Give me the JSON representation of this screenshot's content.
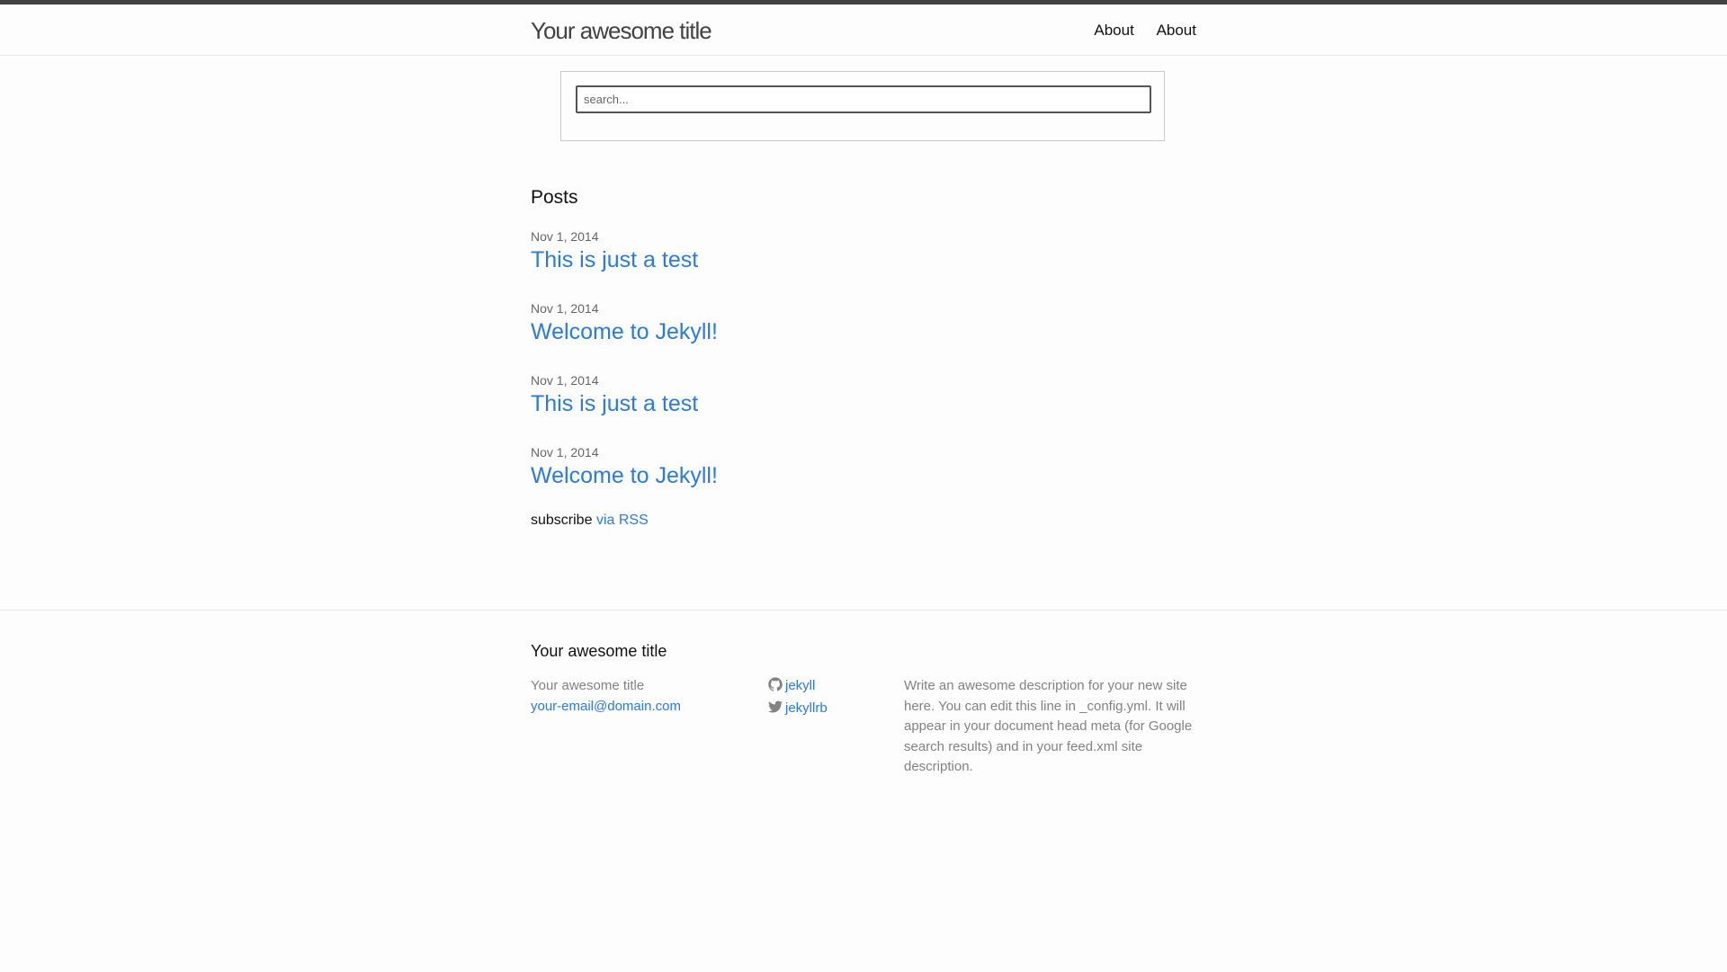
{
  "header": {
    "site_title": "Your awesome title",
    "nav": [
      {
        "label": "About"
      },
      {
        "label": "About"
      }
    ]
  },
  "search": {
    "placeholder": "search...",
    "value": ""
  },
  "main": {
    "heading": "Posts",
    "posts": [
      {
        "date": "Nov 1, 2014",
        "title": "This is just a test"
      },
      {
        "date": "Nov 1, 2014",
        "title": "Welcome to Jekyll!"
      },
      {
        "date": "Nov 1, 2014",
        "title": "This is just a test"
      },
      {
        "date": "Nov 1, 2014",
        "title": "Welcome to Jekyll!"
      }
    ],
    "rss": {
      "prefix": "subscribe",
      "link_label": "via RSS"
    }
  },
  "footer": {
    "heading": "Your awesome title",
    "name": "Your awesome title",
    "email": "your-email@domain.com",
    "social": [
      {
        "icon": "github-icon",
        "username": "jekyll"
      },
      {
        "icon": "twitter-icon",
        "username": "jekyllrb"
      }
    ],
    "description": "Write an awesome description for your new site here. You can edit this line in _config.yml. It will appear in your document head meta (for Google search results) and in your feed.xml site description."
  },
  "colors": {
    "link": "#2a7ae2",
    "text": "#111111",
    "muted": "#828282",
    "header_border": "#424242"
  }
}
